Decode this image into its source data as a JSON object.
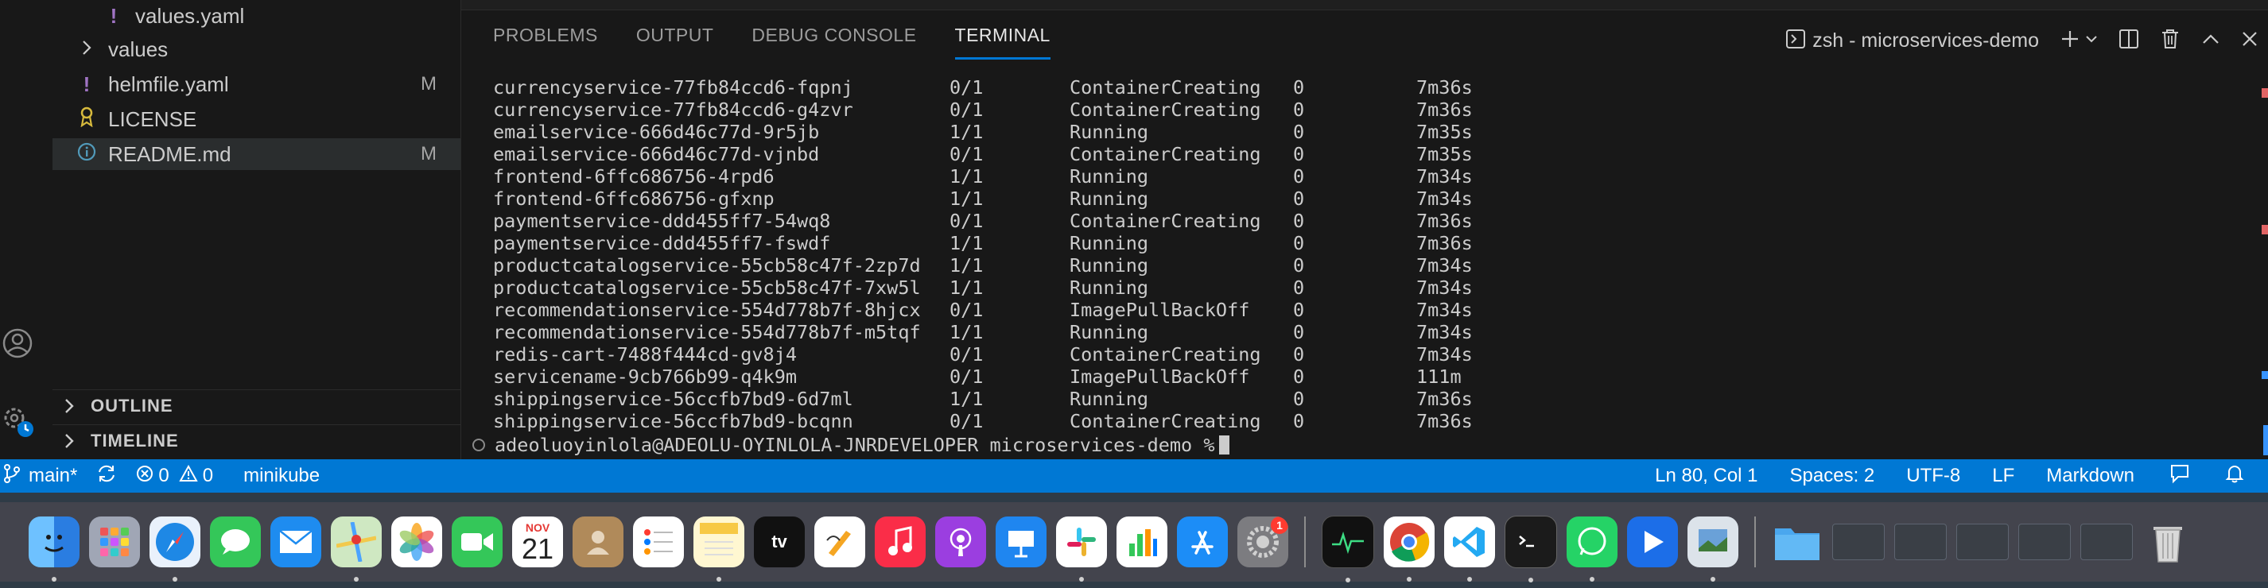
{
  "explorer": {
    "files": [
      {
        "name": "values.yaml",
        "icon": "yaml-icon",
        "badge": ""
      },
      {
        "name": "values",
        "icon": "chevron-right-icon",
        "badge": ""
      },
      {
        "name": "helmfile.yaml",
        "icon": "yaml-icon",
        "badge": "M"
      },
      {
        "name": "LICENSE",
        "icon": "license-icon",
        "badge": ""
      },
      {
        "name": "README.md",
        "icon": "info-icon",
        "badge": "M"
      }
    ],
    "sections": {
      "outline": "OUTLINE",
      "timeline": "TIMELINE"
    }
  },
  "panel": {
    "tabs": [
      "PROBLEMS",
      "OUTPUT",
      "DEBUG CONSOLE",
      "TERMINAL"
    ],
    "active_tab": "TERMINAL",
    "terminal_title": "zsh - microservices-demo"
  },
  "terminal": {
    "rows": [
      [
        "currencyservice-77fb84ccd6-fqpnj",
        "0/1",
        "ContainerCreating",
        "0",
        "7m36s"
      ],
      [
        "currencyservice-77fb84ccd6-g4zvr",
        "0/1",
        "ContainerCreating",
        "0",
        "7m36s"
      ],
      [
        "emailservice-666d46c77d-9r5jb",
        "1/1",
        "Running",
        "0",
        "7m35s"
      ],
      [
        "emailservice-666d46c77d-vjnbd",
        "0/1",
        "ContainerCreating",
        "0",
        "7m35s"
      ],
      [
        "frontend-6ffc686756-4rpd6",
        "1/1",
        "Running",
        "0",
        "7m34s"
      ],
      [
        "frontend-6ffc686756-gfxnp",
        "1/1",
        "Running",
        "0",
        "7m34s"
      ],
      [
        "paymentservice-ddd455ff7-54wq8",
        "0/1",
        "ContainerCreating",
        "0",
        "7m36s"
      ],
      [
        "paymentservice-ddd455ff7-fswdf",
        "1/1",
        "Running",
        "0",
        "7m36s"
      ],
      [
        "productcatalogservice-55cb58c47f-2zp7d",
        "1/1",
        "Running",
        "0",
        "7m34s"
      ],
      [
        "productcatalogservice-55cb58c47f-7xw5l",
        "1/1",
        "Running",
        "0",
        "7m34s"
      ],
      [
        "recommendationservice-554d778b7f-8hjcx",
        "0/1",
        "ImagePullBackOff",
        "0",
        "7m34s"
      ],
      [
        "recommendationservice-554d778b7f-m5tqf",
        "1/1",
        "Running",
        "0",
        "7m34s"
      ],
      [
        "redis-cart-7488f444cd-gv8j4",
        "0/1",
        "ContainerCreating",
        "0",
        "7m34s"
      ],
      [
        "servicename-9cb766b99-q4k9m",
        "0/1",
        "ImagePullBackOff",
        "0",
        "111m"
      ],
      [
        "shippingservice-56ccfb7bd9-6d7ml",
        "1/1",
        "Running",
        "0",
        "7m36s"
      ],
      [
        "shippingservice-56ccfb7bd9-bcqnn",
        "0/1",
        "ContainerCreating",
        "0",
        "7m36s"
      ]
    ],
    "prompt": "adeoluoyinlola@ADEOLU-OYINLOLA-JNRDEVELOPER microservices-demo %"
  },
  "statusbar": {
    "branch": "main*",
    "errors": "0",
    "warnings": "0",
    "context": "minikube",
    "position": "Ln 80, Col 1",
    "spaces": "Spaces: 2",
    "encoding": "UTF-8",
    "eol": "LF",
    "language": "Markdown"
  },
  "dock": {
    "calendar_month": "NOV",
    "calendar_day": "21",
    "settings_badge": "1",
    "appletv_label": "tv",
    "apps": [
      "finder",
      "launchpad",
      "safari",
      "messages",
      "mail",
      "maps",
      "photos",
      "facetime",
      "calendar",
      "contacts",
      "reminders",
      "notes",
      "apple-tv",
      "freeform",
      "music",
      "podcasts",
      "keynote",
      "slack",
      "numbers",
      "app-store",
      "system-settings",
      "activity-monitor",
      "chrome",
      "vscode",
      "terminal",
      "whatsapp",
      "prime-video",
      "preview",
      "folder",
      "trash"
    ]
  },
  "colors": {
    "accent": "#0078d4",
    "status_bar": "#0078d4",
    "editor_bg": "#181818"
  }
}
